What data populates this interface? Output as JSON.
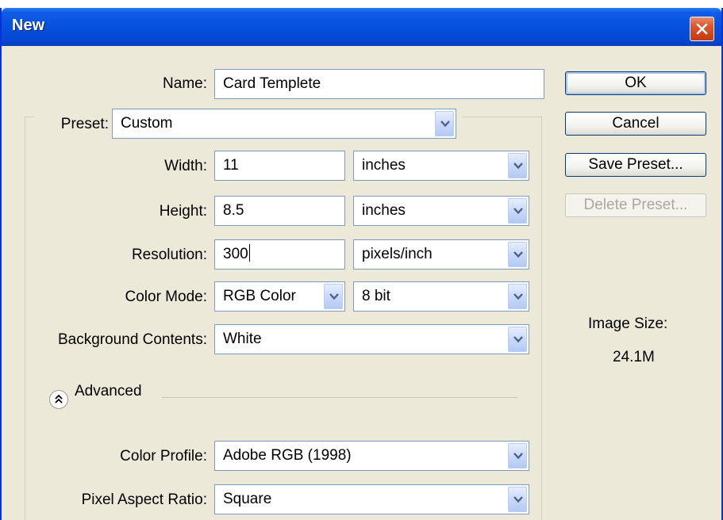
{
  "dialog": {
    "title": "New"
  },
  "name": {
    "label": "Name:",
    "value": "Card Templete"
  },
  "preset": {
    "label": "Preset:",
    "value": "Custom"
  },
  "width": {
    "label": "Width:",
    "value": "11",
    "unit": "inches"
  },
  "height": {
    "label": "Height:",
    "value": "8.5",
    "unit": "inches"
  },
  "resolution": {
    "label": "Resolution:",
    "value": "300",
    "unit": "pixels/inch"
  },
  "color_mode": {
    "label": "Color Mode:",
    "value": "RGB Color",
    "depth": "8 bit"
  },
  "background": {
    "label": "Background Contents:",
    "value": "White"
  },
  "advanced": {
    "label": "Advanced"
  },
  "color_profile": {
    "label": "Color Profile:",
    "value": "Adobe RGB (1998)"
  },
  "pixel_aspect": {
    "label": "Pixel Aspect Ratio:",
    "value": "Square"
  },
  "buttons": {
    "ok": "OK",
    "cancel": "Cancel",
    "save_preset": "Save Preset...",
    "delete_preset": "Delete Preset..."
  },
  "image_size": {
    "label": "Image Size:",
    "value": "24.1M"
  },
  "icons": {
    "close": "close-icon",
    "dropdown": "chevron-down-icon",
    "advanced_toggle": "double-chevron-up-icon"
  },
  "colors": {
    "titlebar": "#0651dd",
    "dialog_bg": "#ece9d8",
    "close_button": "#d9542c"
  }
}
